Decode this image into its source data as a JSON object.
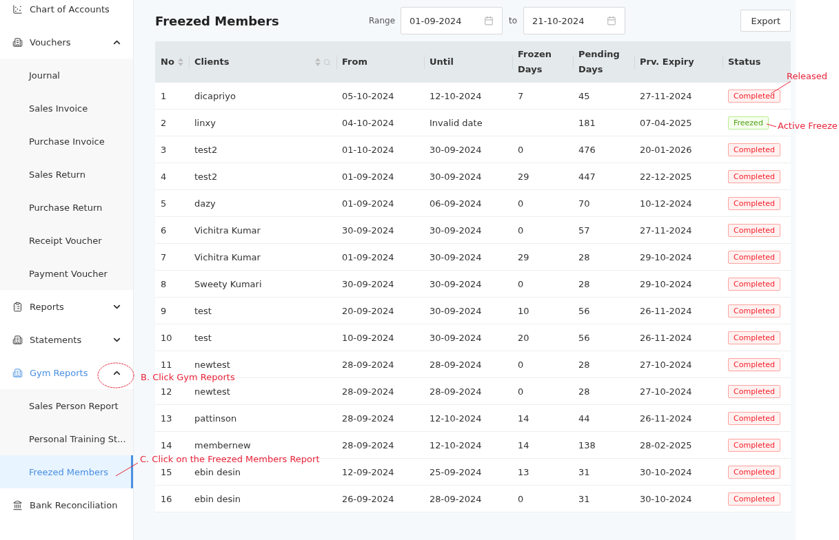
{
  "sidebar": {
    "items": [
      {
        "label": "Chart of Accounts",
        "active": false
      },
      {
        "label": "Vouchers",
        "active": false,
        "expanded": true,
        "children": [
          {
            "label": "Journal",
            "selected": false
          },
          {
            "label": "Sales Invoice",
            "selected": false
          },
          {
            "label": "Purchase Invoice",
            "selected": false
          },
          {
            "label": "Sales Return",
            "selected": false
          },
          {
            "label": "Purchase Return",
            "selected": false
          },
          {
            "label": "Receipt Voucher",
            "selected": false
          },
          {
            "label": "Payment Voucher",
            "selected": false
          }
        ]
      },
      {
        "label": "Reports",
        "active": false,
        "expanded": false
      },
      {
        "label": "Statements",
        "active": false,
        "expanded": false
      },
      {
        "label": "Gym Reports",
        "active": true,
        "expanded": true,
        "children": [
          {
            "label": "Sales Person Report",
            "selected": false
          },
          {
            "label": "Personal Training St...",
            "selected": false
          },
          {
            "label": "Freezed Members",
            "selected": true
          }
        ]
      },
      {
        "label": "Bank Reconciliation",
        "active": false
      }
    ]
  },
  "page": {
    "title": "Freezed Members",
    "range_label": "Range",
    "from_date": "01-09-2024",
    "to_label": "to",
    "to_date": "21-10-2024",
    "export_button": "Export"
  },
  "table": {
    "columns": [
      {
        "label": "No",
        "sortable": true,
        "searchable": false
      },
      {
        "label": "Clients",
        "sortable": true,
        "searchable": true
      },
      {
        "label": "From"
      },
      {
        "label": "Until"
      },
      {
        "label": "Frozen Days"
      },
      {
        "label": "Pending Days"
      },
      {
        "label": "Prv. Expiry"
      },
      {
        "label": "Status"
      }
    ],
    "rows": [
      {
        "no": "1",
        "client": "dicapriyo",
        "from": "05-10-2024",
        "until": "12-10-2024",
        "frozen_days": "7",
        "pending_days": "45",
        "prv_expiry": "27-11-2024",
        "status": {
          "label": "Completed",
          "kind": "completed"
        }
      },
      {
        "no": "2",
        "client": "linxy",
        "from": "04-10-2024",
        "until": "Invalid date",
        "pending_days": "181",
        "prv_expiry": "07-04-2025",
        "status": {
          "label": "Freezed",
          "kind": "freezed"
        }
      },
      {
        "no": "3",
        "client": "test2",
        "from": "01-10-2024",
        "until": "30-09-2024",
        "frozen_days": "0",
        "pending_days": "476",
        "prv_expiry": "20-01-2026",
        "status": {
          "label": "Completed",
          "kind": "completed"
        }
      },
      {
        "no": "4",
        "client": "test2",
        "from": "01-09-2024",
        "until": "30-09-2024",
        "frozen_days": "29",
        "pending_days": "447",
        "prv_expiry": "22-12-2025",
        "status": {
          "label": "Completed",
          "kind": "completed"
        }
      },
      {
        "no": "5",
        "client": "dazy",
        "from": "01-09-2024",
        "until": "06-09-2024",
        "frozen_days": "0",
        "pending_days": "70",
        "prv_expiry": "10-12-2024",
        "status": {
          "label": "Completed",
          "kind": "completed"
        }
      },
      {
        "no": "6",
        "client": "Vichitra Kumar",
        "from": "30-09-2024",
        "until": "30-09-2024",
        "frozen_days": "0",
        "pending_days": "57",
        "prv_expiry": "27-11-2024",
        "status": {
          "label": "Completed",
          "kind": "completed"
        }
      },
      {
        "no": "7",
        "client": "Vichitra Kumar",
        "from": "01-09-2024",
        "until": "30-09-2024",
        "frozen_days": "29",
        "pending_days": "28",
        "prv_expiry": "29-10-2024",
        "status": {
          "label": "Completed",
          "kind": "completed"
        }
      },
      {
        "no": "8",
        "client": "Sweety Kumari",
        "from": "30-09-2024",
        "until": "30-09-2024",
        "frozen_days": "0",
        "pending_days": "28",
        "prv_expiry": "29-10-2024",
        "status": {
          "label": "Completed",
          "kind": "completed"
        }
      },
      {
        "no": "9",
        "client": "test",
        "from": "20-09-2024",
        "until": "30-09-2024",
        "frozen_days": "10",
        "pending_days": "56",
        "prv_expiry": "26-11-2024",
        "status": {
          "label": "Completed",
          "kind": "completed"
        }
      },
      {
        "no": "10",
        "client": "test",
        "from": "10-09-2024",
        "until": "30-09-2024",
        "frozen_days": "20",
        "pending_days": "56",
        "prv_expiry": "26-11-2024",
        "status": {
          "label": "Completed",
          "kind": "completed"
        }
      },
      {
        "no": "11",
        "client": "newtest",
        "from": "28-09-2024",
        "until": "28-09-2024",
        "frozen_days": "0",
        "pending_days": "28",
        "prv_expiry": "27-10-2024",
        "status": {
          "label": "Completed",
          "kind": "completed"
        }
      },
      {
        "no": "12",
        "client": "newtest",
        "from": "28-09-2024",
        "until": "28-09-2024",
        "frozen_days": "0",
        "pending_days": "28",
        "prv_expiry": "27-10-2024",
        "status": {
          "label": "Completed",
          "kind": "completed"
        }
      },
      {
        "no": "13",
        "client": "pattinson",
        "from": "28-09-2024",
        "until": "12-10-2024",
        "frozen_days": "14",
        "pending_days": "44",
        "prv_expiry": "26-11-2024",
        "status": {
          "label": "Completed",
          "kind": "completed"
        }
      },
      {
        "no": "14",
        "client": "membernew",
        "from": "28-09-2024",
        "until": "12-10-2024",
        "frozen_days": "14",
        "pending_days": "138",
        "prv_expiry": "28-02-2025",
        "status": {
          "label": "Completed",
          "kind": "completed"
        }
      },
      {
        "no": "15",
        "client": "ebin desin",
        "from": "12-09-2024",
        "until": "25-09-2024",
        "frozen_days": "13",
        "pending_days": "31",
        "prv_expiry": "30-10-2024",
        "status": {
          "label": "Completed",
          "kind": "completed"
        }
      },
      {
        "no": "16",
        "client": "ebin desin",
        "from": "26-09-2024",
        "until": "28-09-2024",
        "frozen_days": "0",
        "pending_days": "31",
        "prv_expiry": "30-10-2024",
        "status": {
          "label": "Completed",
          "kind": "completed"
        }
      }
    ]
  },
  "annotations": [
    {
      "text": "Released"
    },
    {
      "text": "Active Freeze"
    },
    {
      "text": "B. Click Gym Reports"
    },
    {
      "text": "C. Click on the Freezed Members Report"
    }
  ]
}
